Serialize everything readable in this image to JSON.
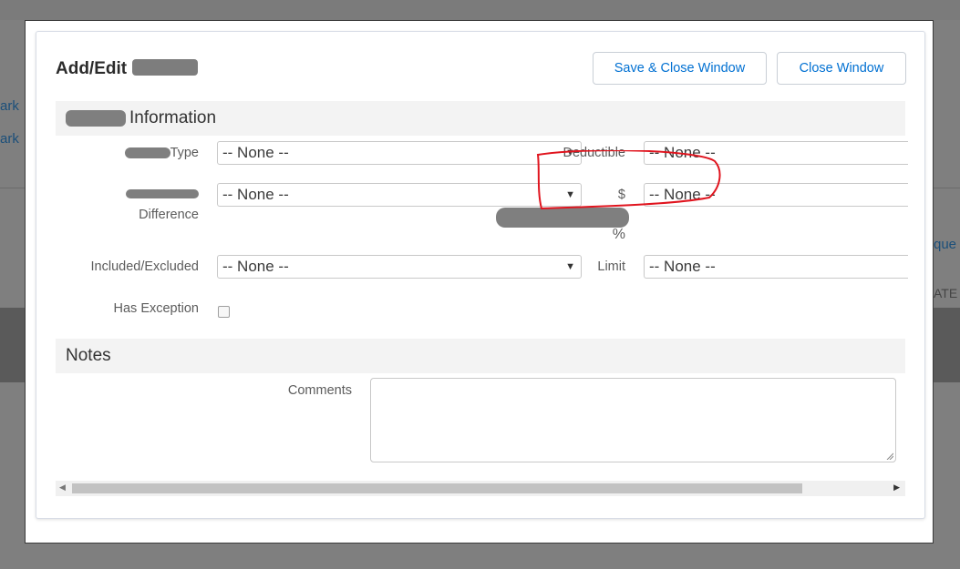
{
  "background": {
    "left_links": [
      "ark",
      "ark"
    ],
    "right_texts": [
      "que",
      "ATE"
    ]
  },
  "modal": {
    "title": "Add/Edit",
    "buttons": {
      "save_close": "Save & Close Window",
      "close": "Close Window"
    },
    "info_section": {
      "heading": "Information",
      "fields": {
        "type_label": "Type",
        "type_value": "-- None --",
        "deductible_label": "Deductible",
        "deductible_value": "-- None --",
        "difference_label": "Difference",
        "difference_value": "-- None --",
        "dollar_label": "$",
        "dollar_value": "-- None --",
        "percent_label": "%",
        "included_excluded_label": "Included/Excluded",
        "included_excluded_value": "-- None --",
        "limit_label": "Limit",
        "limit_value": "-- None --",
        "has_exception_label": "Has Exception"
      }
    },
    "notes_section": {
      "heading": "Notes",
      "comments_label": "Comments",
      "comments_value": ""
    }
  },
  "colors": {
    "link_blue": "#0070d2",
    "section_bg": "#f3f3f3",
    "annotation_red": "#e0141e",
    "overlay_gray": "#7b7b7b"
  },
  "icons": {
    "select_arrow": "dropdown-arrow-icon",
    "scroll_left": "scroll-left-icon",
    "scroll_right": "scroll-right-icon",
    "resize": "resize-grip-icon"
  }
}
